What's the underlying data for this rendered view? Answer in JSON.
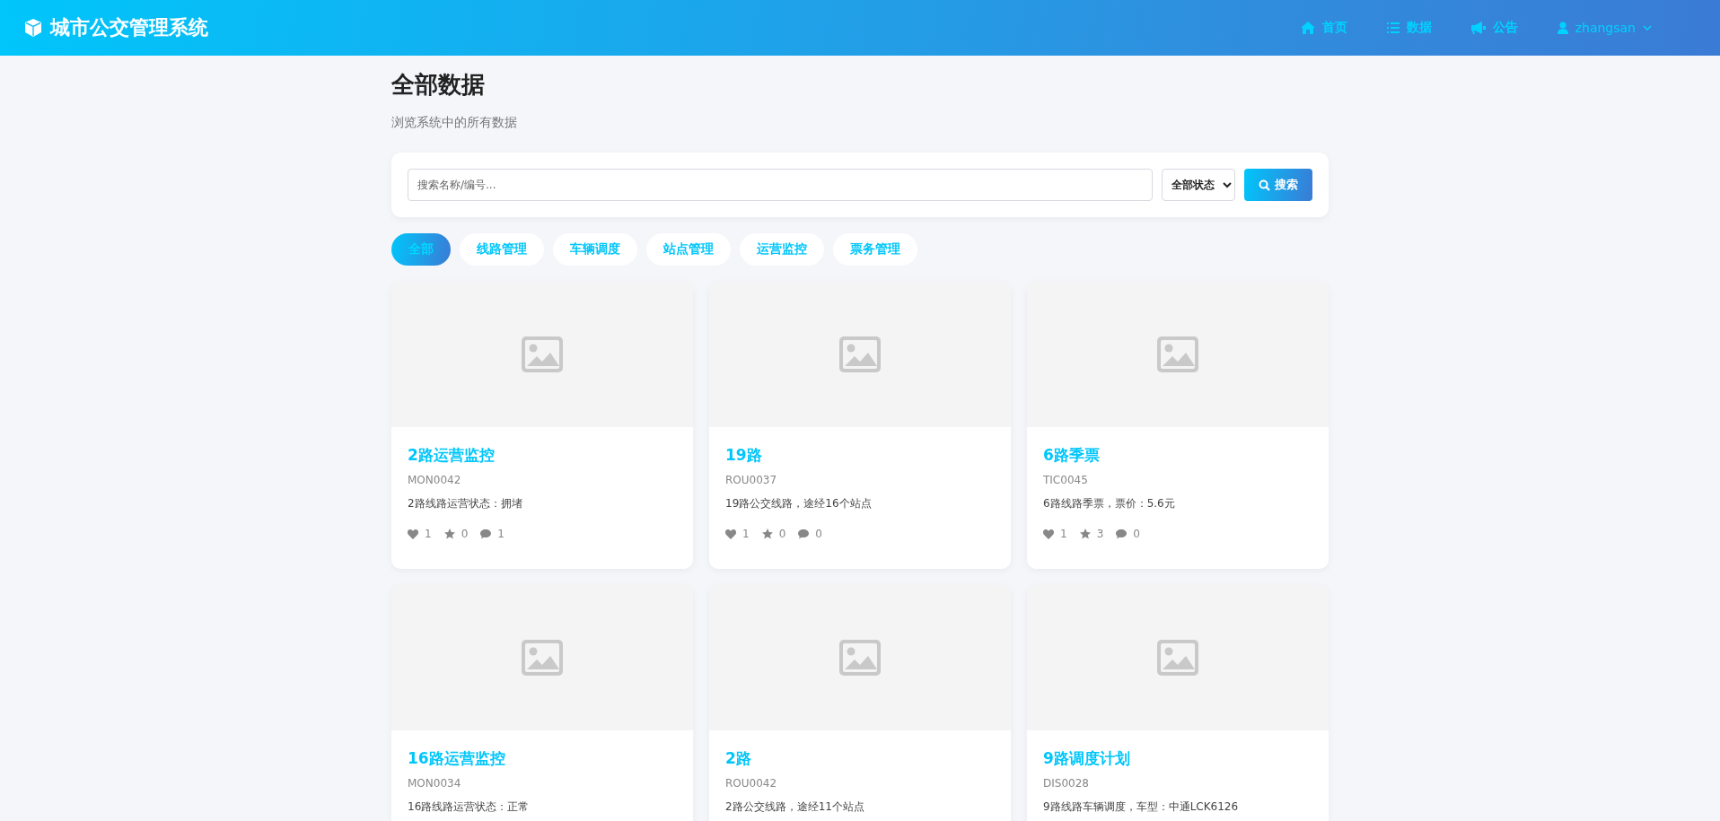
{
  "header": {
    "logo": "城市公交管理系统",
    "nav": [
      {
        "label": "首页"
      },
      {
        "label": "数据"
      },
      {
        "label": "公告"
      }
    ],
    "user": {
      "name": "zhangsan"
    }
  },
  "page": {
    "title": "全部数据",
    "subtitle": "浏览系统中的所有数据"
  },
  "search": {
    "placeholder": "搜索名称/编号...",
    "status_filter": "全部状态",
    "button": "搜索"
  },
  "categories": [
    {
      "label": "全部",
      "selected": true
    },
    {
      "label": "线路管理",
      "selected": false
    },
    {
      "label": "车辆调度",
      "selected": false
    },
    {
      "label": "站点管理",
      "selected": false
    },
    {
      "label": "运营监控",
      "selected": false
    },
    {
      "label": "票务管理",
      "selected": false
    }
  ],
  "items": [
    {
      "title": "2路运营监控",
      "code": "MON0042",
      "description": "2路线路运营状态：拥堵",
      "likes": "1",
      "favorites": "0",
      "comments": "1"
    },
    {
      "title": "19路",
      "code": "ROU0037",
      "description": "19路公交线路，途经16个站点",
      "likes": "1",
      "favorites": "0",
      "comments": "0"
    },
    {
      "title": "6路季票",
      "code": "TIC0045",
      "description": "6路线路季票，票价：5.6元",
      "likes": "1",
      "favorites": "3",
      "comments": "0"
    },
    {
      "title": "16路运营监控",
      "code": "MON0034",
      "description": "16路线路运营状态：正常"
    },
    {
      "title": "2路",
      "code": "ROU0042",
      "description": "2路公交线路，途经11个站点"
    },
    {
      "title": "9路调度计划",
      "code": "DIS0028",
      "description": "9路线路车辆调度，车型：中通LCK6126"
    }
  ]
}
